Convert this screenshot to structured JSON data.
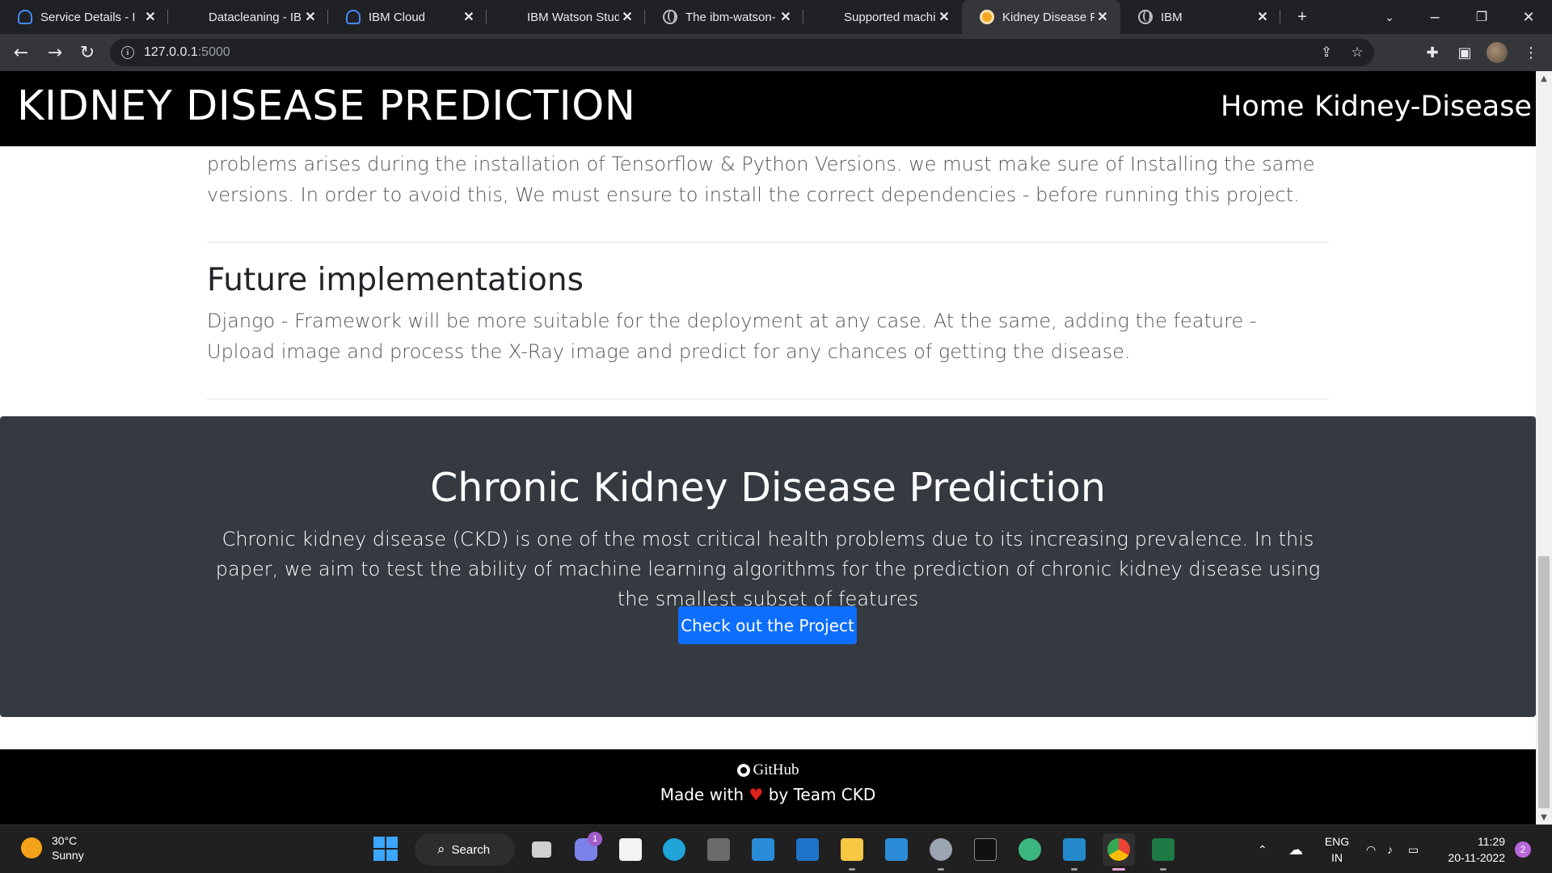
{
  "browser": {
    "tabs": [
      {
        "title": "Service Details - I",
        "icon": "ibm-cloud-icon",
        "active": false
      },
      {
        "title": "Datacleaning - IBI",
        "icon": "none",
        "active": false
      },
      {
        "title": "IBM Cloud",
        "icon": "ibm-cloud-icon",
        "active": false
      },
      {
        "title": "IBM Watson Stud",
        "icon": "none",
        "active": false
      },
      {
        "title": "The ibm-watson-",
        "icon": "globe-icon",
        "active": false
      },
      {
        "title": "Supported machi",
        "icon": "none",
        "active": false
      },
      {
        "title": "Kidney Disease Pr",
        "icon": "kidney-favicon",
        "active": true
      },
      {
        "title": "IBM",
        "icon": "globe-icon",
        "active": false
      }
    ],
    "tab_close_glyph": "✕",
    "new_tab_glyph": "+",
    "address": {
      "host": "127.0.0.1",
      "port": ":5000"
    }
  },
  "site": {
    "title": "KIDNEY DISEASE PREDICTION",
    "nav": [
      "Home",
      "Kidney-Disease"
    ],
    "prior_paragraph": "problems arises during the installation of Tensorflow & Python Versions. we must make sure of Installing the same versions. In order to avoid this, We must ensure to install the correct dependencies - before running this project.",
    "future": {
      "heading": "Future implementations",
      "text": "Django - Framework will be more suitable for the deployment at any case. At the same, adding the feature - Upload image and process the X-Ray image and predict for any chances of getting the disease."
    },
    "hero": {
      "title": "Chronic Kidney Disease Prediction",
      "text": "Chronic kidney disease (CKD) is one of the most critical health problems due to its increasing prevalence. In this paper, we aim to test the ability of machine learning algorithms for the prediction of chronic kidney disease using the smallest subset of features",
      "button": "Check out the Project"
    },
    "footer": {
      "github": "GitHub",
      "made_prefix": "Made with",
      "heart": "♥",
      "made_suffix": "by Team CKD"
    }
  },
  "taskbar": {
    "weather": {
      "temp": "30°C",
      "condition": "Sunny"
    },
    "search_label": "Search",
    "chat_badge": "1",
    "language": {
      "line1": "ENG",
      "line2": "IN"
    },
    "clock": {
      "time": "11:29",
      "date": "20-11-2022"
    },
    "notification_count": "2"
  },
  "colors": {
    "header_bg": "#000000",
    "hero_bg": "#343a40",
    "primary_button": "#0d6efd",
    "heart": "#e0201b"
  }
}
